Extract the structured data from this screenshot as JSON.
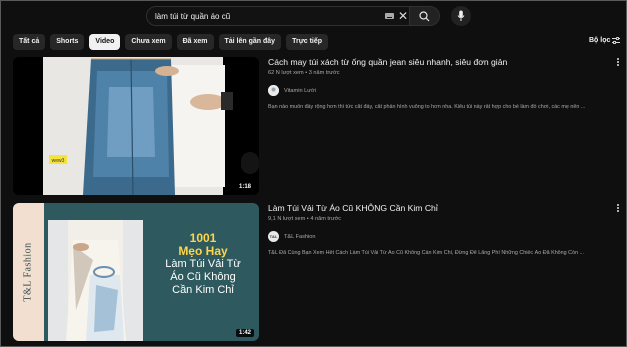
{
  "search": {
    "value": "làm túi từ quần áo cũ"
  },
  "chips": [
    "Tất cả",
    "Shorts",
    "Video",
    "Chưa xem",
    "Đã xem",
    "Tải lên gần đây",
    "Trực tiếp"
  ],
  "active_chip": "Video",
  "filters_label": "Bộ lọc",
  "results": [
    {
      "title": "Cách may túi xách từ ống quần jean siêu nhanh, siêu đơn giản",
      "meta": "62 N lượt xem • 3 năm trước",
      "channel": "Vitamin Lười",
      "description": "Bạn nào muốn đáy rộng hơn thì tức cắt đáy, cắt phần hình vuông to hơn nha. Kiểu túi này rất hợp cho bé làm đồ chơi, các mẹ nên ...",
      "duration": "1:18",
      "sticker": "wew3"
    },
    {
      "title": "Làm Túi Vải Từ Áo Cũ KHÔNG Cần Kim Chỉ",
      "meta": "9,1 N lượt xem • 4 năm trước",
      "channel": "T&L Fashion",
      "channel_avatar": "T&L",
      "description": "T&L Đã Cùng Bạn Xem Hết Cách Làm Túi Vải Từ Áo Cũ Không Cần Kim Chỉ, Đừng Để Lãng Phí Những Chiếc Áo Đã Không Còn ...",
      "duration": "1:42",
      "poster": {
        "side_text": "T&L Fashion",
        "line1": "1001",
        "line2": "Mẹo Hay",
        "line3": "Làm Túi Vải Từ",
        "line4": "Áo Cũ Không",
        "line5": "Cần Kim Chỉ"
      }
    }
  ]
}
